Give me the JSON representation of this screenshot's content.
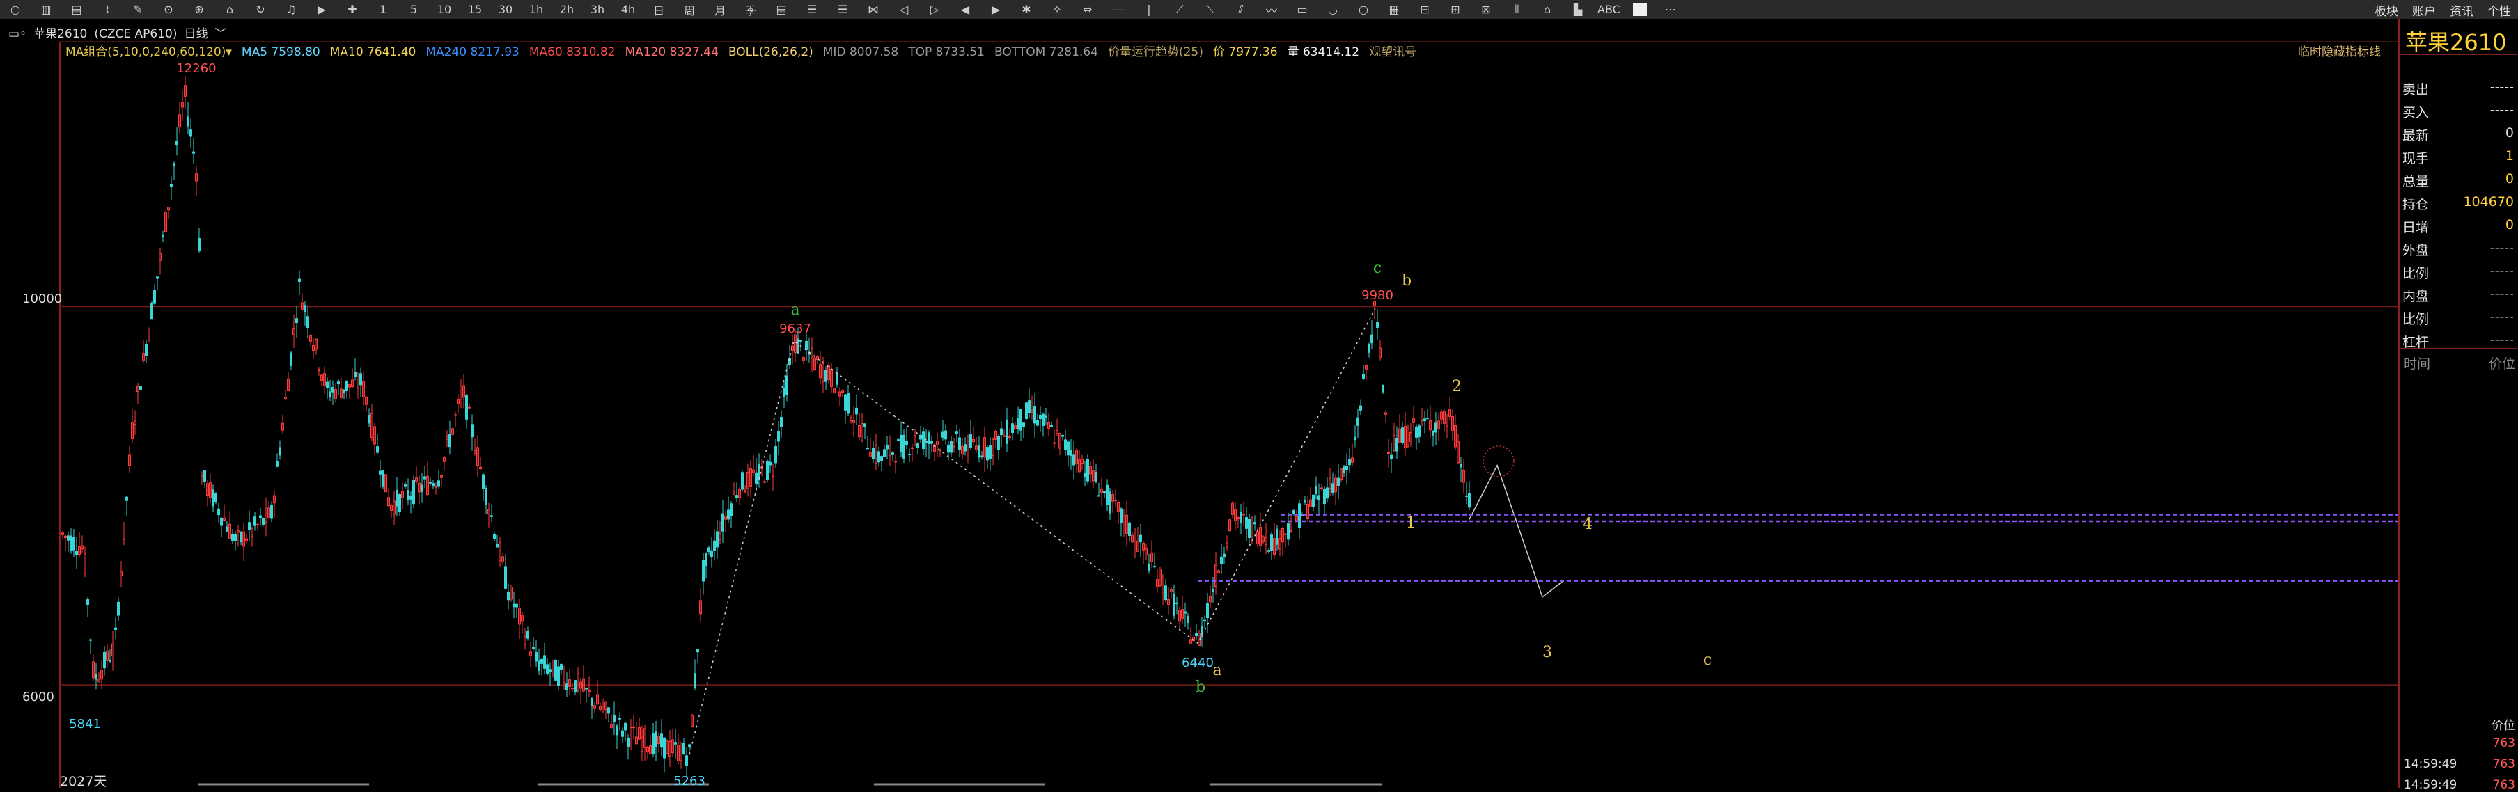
{
  "toolbar": {
    "icons": [
      "○",
      "▥",
      "▤",
      "⌇",
      "✎",
      "⊙",
      "⊕",
      "⌂",
      "↻",
      "♫",
      "▶",
      "✚",
      "1",
      "5",
      "10",
      "15",
      "30",
      "1h",
      "2h",
      "3h",
      "4h",
      "日",
      "周",
      "月",
      "季",
      "▤",
      "☰",
      "☰",
      "⋈",
      "◁",
      "▷",
      "◀",
      "▶",
      "✱",
      "✧",
      "⇔",
      "—",
      "|",
      "⟋",
      "⟍",
      "⫽",
      "〰",
      "▭",
      "◡",
      "○",
      "▦",
      "⊟",
      "⊞",
      "⊠",
      "⦀",
      "⌂",
      "▙",
      "ABC"
    ],
    "right_menu": [
      "板块",
      "账户",
      "资讯",
      "个性"
    ],
    "more": "⋯"
  },
  "header": {
    "title": "苹果2610",
    "code": "(CZCE AP610)",
    "period": "日线",
    "prefix": "▭◦"
  },
  "indicators": [
    {
      "text": "MA组合(5,10,0,240,60,120)▾",
      "color": "#e6c84a"
    },
    {
      "text": "MA5 7598.80",
      "color": "#60d4ff"
    },
    {
      "text": "MA10 7641.40",
      "color": "#f2d450"
    },
    {
      "text": "MA240 8217.93",
      "color": "#3a8fff"
    },
    {
      "text": "MA60 8310.82",
      "color": "#ff4a4a"
    },
    {
      "text": "MA120 8327.44",
      "color": "#ff6f6f"
    },
    {
      "text": "BOLL(26,26,2)",
      "color": "#f0d070"
    },
    {
      "text": "MID 8007.58",
      "color": "#9a9a9a"
    },
    {
      "text": "TOP 8733.51",
      "color": "#9a9a9a"
    },
    {
      "text": "BOTTOM 7281.64",
      "color": "#9a9a9a"
    },
    {
      "text": "价量运行趋势(25)",
      "color": "#b8a060"
    },
    {
      "text": "价 7977.36",
      "color": "#f2d450"
    },
    {
      "text": "量 63414.12",
      "color": "#f2f2f2"
    },
    {
      "text": "观望讯号",
      "color": "#b8a060"
    }
  ],
  "hide_indicator": "临时隐藏指标线",
  "axis": {
    "upper": "10000",
    "lower": "6000",
    "days": "2027天"
  },
  "chart_data": {
    "type": "candlestick",
    "y_range": [
      5000,
      12800
    ],
    "levels": [
      10000,
      6000
    ],
    "peaks": [
      {
        "label": "12260",
        "value": 12260,
        "color": "#ff5050"
      },
      {
        "label": "5841",
        "value": 5841,
        "color": "#4ad8ff"
      },
      {
        "label": "5263",
        "value": 5263,
        "color": "#4ad8ff"
      },
      {
        "label": "9637",
        "value": 9637,
        "color": "#ff5050"
      },
      {
        "label": "6440",
        "value": 6440,
        "color": "#4ad8ff"
      },
      {
        "label": "9980",
        "value": 9980,
        "color": "#ff5050"
      }
    ],
    "wave_labels": [
      {
        "text": "a",
        "color": "#3fbf3f"
      },
      {
        "text": "c",
        "color": "#3fbf3f"
      },
      {
        "text": "b",
        "color": "#e6c84a"
      },
      {
        "text": "2",
        "color": "#e6c84a"
      },
      {
        "text": "1",
        "color": "#e6c84a"
      },
      {
        "text": "4",
        "color": "#e6c84a"
      },
      {
        "text": "a",
        "color": "#e6c84a"
      },
      {
        "text": "b",
        "color": "#3fbf3f"
      },
      {
        "text": "3",
        "color": "#e6c84a"
      },
      {
        "text": "c",
        "color": "#e6c84a"
      }
    ],
    "support_lines": [
      7800,
      7730,
      7100
    ]
  },
  "panel": {
    "title": "苹果2610",
    "rows": [
      {
        "k": "卖出",
        "v": "-----",
        "y": false
      },
      {
        "k": "买入",
        "v": "-----",
        "y": false
      },
      {
        "k": "最新",
        "v": "0",
        "y": false
      },
      {
        "k": "现手",
        "v": "1",
        "y": true
      },
      {
        "k": "总量",
        "v": "0",
        "y": true
      },
      {
        "k": "持仓",
        "v": "104670",
        "y": true
      },
      {
        "k": "日增",
        "v": "0",
        "y": true
      },
      {
        "k": "外盘",
        "v": "-----",
        "y": false
      },
      {
        "k": "比例",
        "v": "-----",
        "y": false
      },
      {
        "k": "内盘",
        "v": "-----",
        "y": false
      },
      {
        "k": "比例",
        "v": "-----",
        "y": false
      },
      {
        "k": "杠杆",
        "v": "-----",
        "y": false
      }
    ],
    "time_header": {
      "time": "时间",
      "price": "价位"
    },
    "ticks": [
      {
        "t": "",
        "p": "价位"
      },
      {
        "t": "",
        "p": "763"
      },
      {
        "t": "14:59:49",
        "p": "763"
      },
      {
        "t": "14:59:49",
        "p": "763"
      }
    ]
  }
}
